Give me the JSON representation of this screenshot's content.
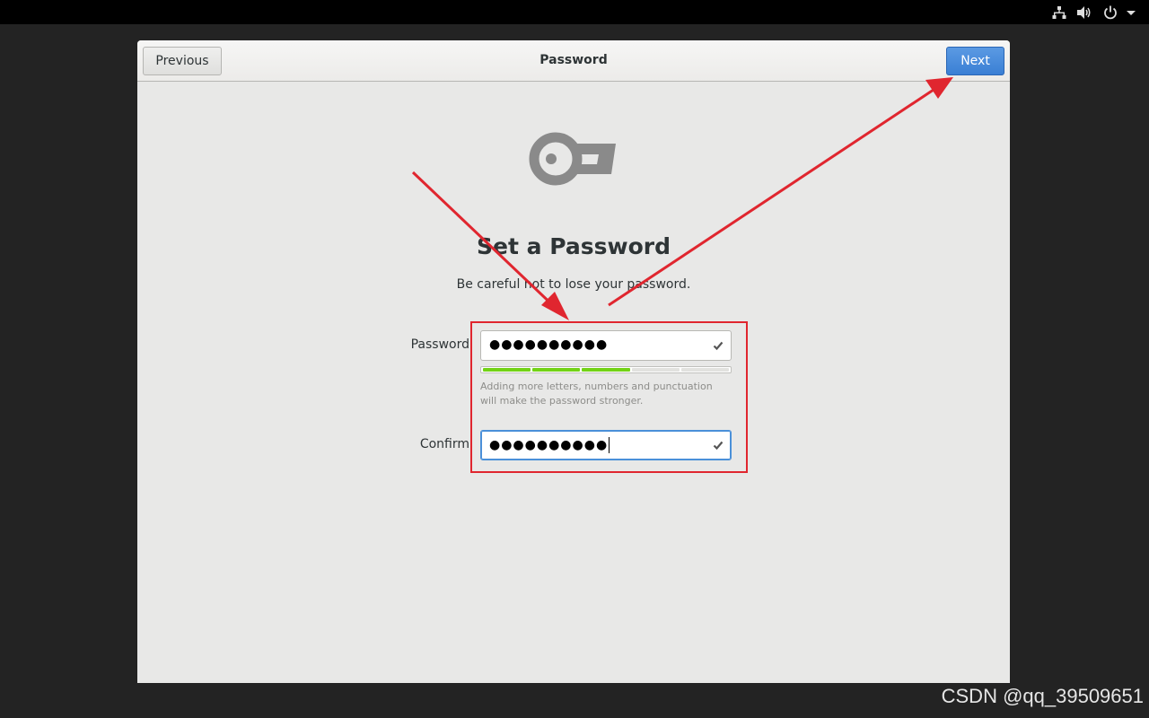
{
  "window": {
    "title": "Password",
    "previous_label": "Previous",
    "next_label": "Next"
  },
  "page": {
    "icon": "key-icon",
    "heading": "Set a Password",
    "subtitle": "Be careful not to lose your password."
  },
  "form": {
    "password_label": "Password",
    "password_value": "●●●●●●●●●●",
    "strength_level": 0.6,
    "strength_segments": 5,
    "strength_filled": 3,
    "hint": "Adding more letters, numbers and punctuation will make the password stronger.",
    "confirm_label": "Confirm",
    "confirm_value": "●●●●●●●●●●",
    "valid_icon": "check-icon"
  },
  "tray": {
    "icons": [
      "network-icon",
      "volume-icon",
      "power-icon",
      "chevron-down-icon"
    ]
  },
  "annotations": {
    "color": "#e0262f",
    "highlight": "red-rectangle",
    "arrows": 2
  },
  "watermark": "CSDN @qq_39509651",
  "colors": {
    "accent": "#3a7fd4",
    "strength": "#73d216",
    "annotation": "#e0262f"
  }
}
